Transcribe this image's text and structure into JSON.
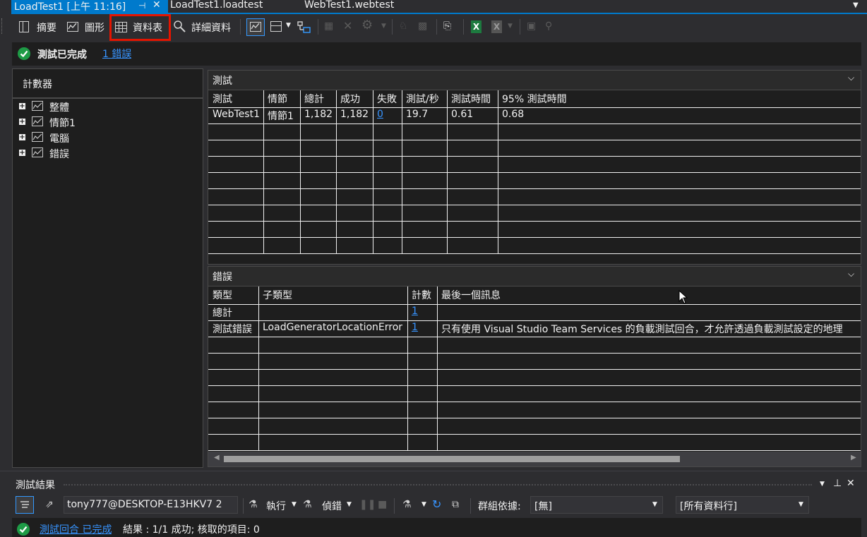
{
  "tabs": {
    "active_label": "LoadTest1 [上午 11:16]",
    "tab2": "LoadTest1.loadtest",
    "tab3": "WebTest1.webtest"
  },
  "toolbar": {
    "summary": "摘要",
    "graphs": "圖形",
    "tables": "資料表",
    "details": "詳細資料"
  },
  "status": {
    "message": "測試已完成",
    "errors_link": "1 錯誤"
  },
  "counters": {
    "header": "計數器",
    "items": [
      "整體",
      "情節1",
      "電腦",
      "錯誤"
    ]
  },
  "tests_table": {
    "title": "測試",
    "columns": [
      "測試",
      "情節",
      "總計",
      "成功",
      "失敗",
      "測試/秒",
      "測試時間",
      "95% 測試時間"
    ],
    "rows": [
      [
        "WebTest1",
        "情節1",
        "1,182",
        "1,182",
        "0",
        "19.7",
        "0.61",
        "0.68"
      ]
    ]
  },
  "errors_table": {
    "title": "錯誤",
    "columns": [
      "類型",
      "子類型",
      "計數",
      "最後一個訊息"
    ],
    "rows": [
      [
        "總計",
        "",
        "1",
        ""
      ],
      [
        "測試錯誤",
        "LoadGeneratorLocationError",
        "1",
        "只有使用 Visual Studio Team Services 的負載測試回合，才允許透過負載測試設定的地理"
      ]
    ]
  },
  "results_pane": {
    "title": "測試結果",
    "user": "tony777@DESKTOP-E13HKV7 2",
    "run": "執行",
    "debug": "偵錯",
    "group_by_label": "群組依據:",
    "group_by_value": "[無]",
    "columns_value": "[所有資料行]",
    "run_link": "測試回合 已完成",
    "summary": "結果 : 1/1 成功;  核取的項目: 0"
  },
  "colors": {
    "accent": "#007acc",
    "success": "#1e9b46",
    "highlight_box": "#e51400",
    "link": "#3794ff"
  }
}
